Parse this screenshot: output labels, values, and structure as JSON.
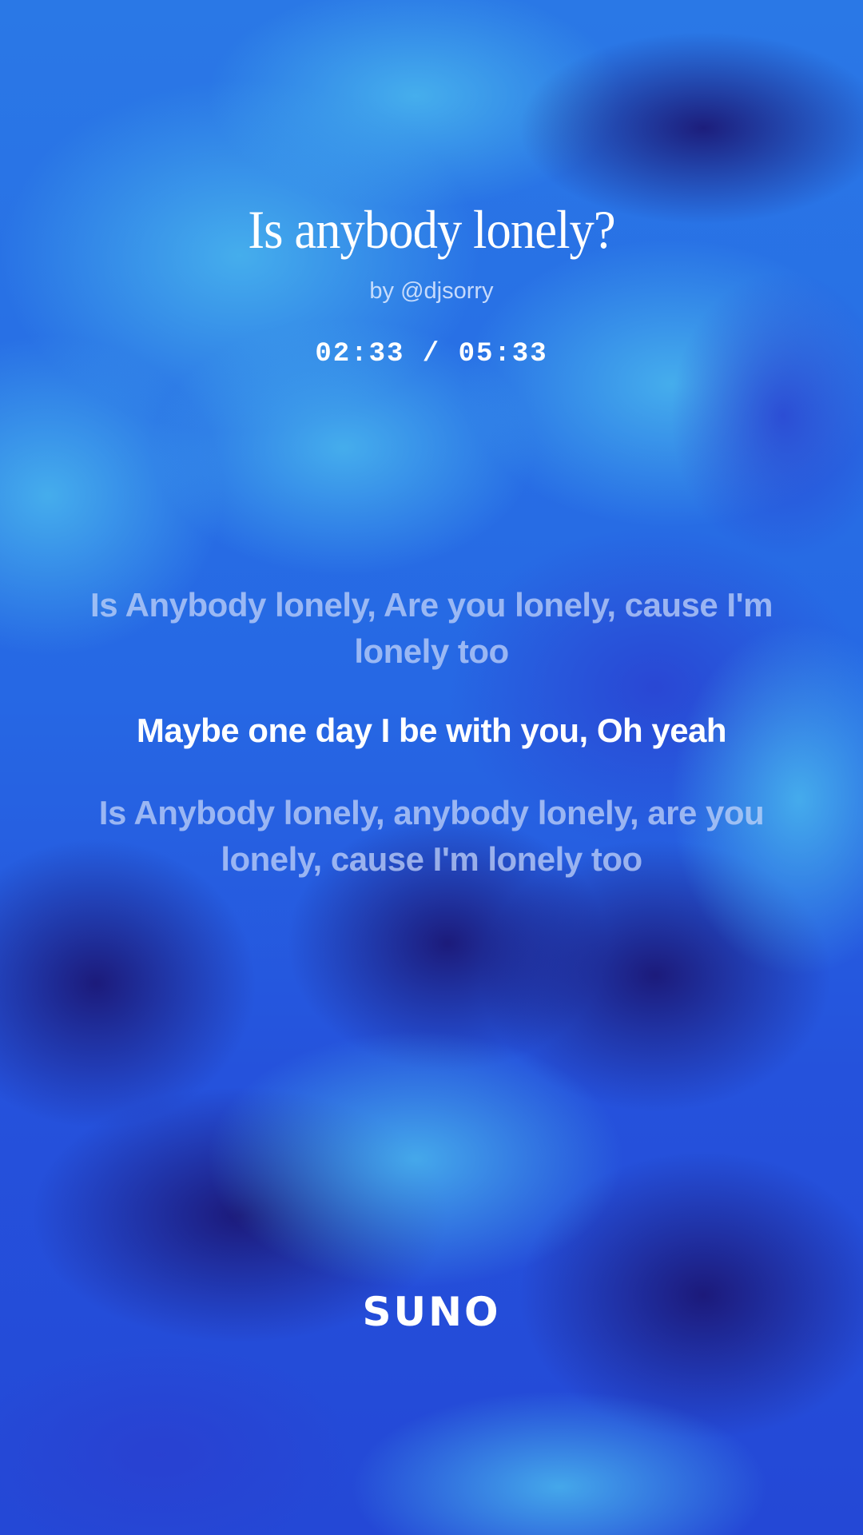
{
  "song": {
    "title": "Is anybody lonely?",
    "artist": "by @djsorry",
    "time": "02:33 / 05:33"
  },
  "lyrics": {
    "previous": "Is Anybody lonely, Are you lonely, cause I'm lonely too",
    "current": "Maybe one day I be with you, Oh yeah",
    "next": "Is Anybody lonely, anybody lonely, are you lonely, cause I'm lonely too"
  },
  "brand": {
    "logo_text": "SUNO"
  },
  "colors": {
    "background": "#1f5fe0",
    "background_dark": "#1c1a7a",
    "background_light": "#3a9ee8",
    "text_active": "#ffffff",
    "text_dim": "#c8d7fa"
  },
  "background_icon": "blue-smoke-texture"
}
